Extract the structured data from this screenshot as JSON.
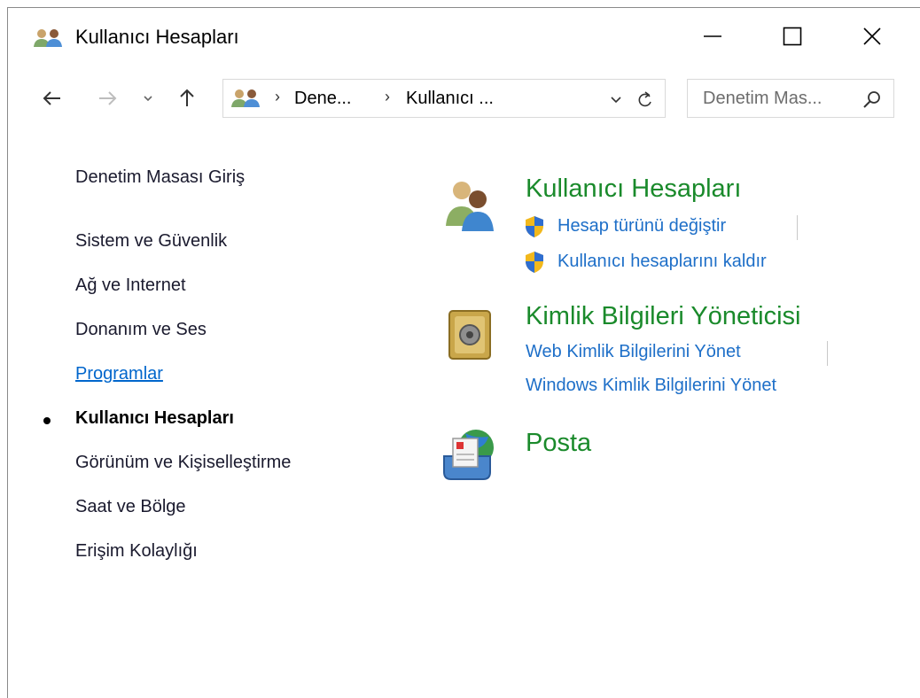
{
  "window": {
    "title": "Kullanıcı Hesapları",
    "title_icon": "users-icon",
    "controls": [
      "minimize-icon",
      "maximize-icon",
      "close-icon"
    ]
  },
  "navigation": {
    "back_icon": "arrow-left-icon",
    "forward_icon": "arrow-right-icon",
    "recent_icon": "chevron-down-icon",
    "up_icon": "arrow-up-icon",
    "breadcrumbs": [
      "Dene...",
      "Kullanıcı ..."
    ],
    "search_placeholder": "Denetim Mas..."
  },
  "sidebar": {
    "items": [
      {
        "label": "Denetim Masası Giriş",
        "state": "normal"
      },
      {
        "label": "Sistem ve Güvenlik",
        "state": "normal"
      },
      {
        "label": "Ağ ve Internet",
        "state": "normal"
      },
      {
        "label": "Donanım ve Ses",
        "state": "normal"
      },
      {
        "label": "Programlar",
        "state": "hover-link"
      },
      {
        "label": "Kullanıcı Hesapları",
        "state": "current"
      },
      {
        "label": "Görünüm ve Kişiselleştirme",
        "state": "normal"
      },
      {
        "label": "Saat ve Bölge",
        "state": "normal"
      },
      {
        "label": "Erişim Kolaylığı",
        "state": "normal"
      }
    ]
  },
  "main": {
    "sections": [
      {
        "title": "Kullanıcı Hesapları",
        "icon": "user-accounts-icon",
        "links": [
          {
            "label": "Hesap türünü değiştir",
            "icon": "uac-shield-icon"
          },
          {
            "label": "Kullanıcı hesaplarını kaldır",
            "icon": "uac-shield-icon"
          }
        ]
      },
      {
        "title": "Kimlik Bilgileri Yöneticisi",
        "icon": "credential-vault-icon",
        "links": [
          {
            "label": "Web Kimlik Bilgilerini Yönet"
          },
          {
            "label": "Windows Kimlik Bilgilerini Yönet"
          }
        ]
      },
      {
        "title": "Posta",
        "icon": "mail-icon",
        "links": []
      }
    ]
  },
  "colors": {
    "section_title": "#1a8a2b",
    "task_link": "#1e6fc8",
    "hover_link": "#0066cc"
  }
}
